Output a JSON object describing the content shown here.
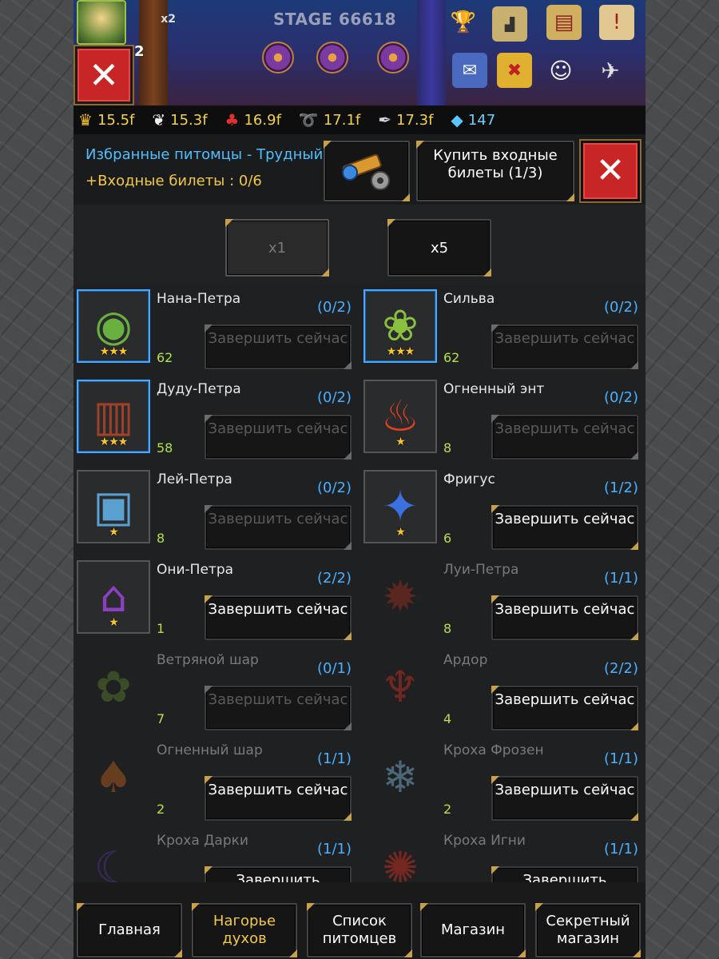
{
  "game": {
    "stage": "STAGE 66618",
    "speed": "x2",
    "hero_level": "2"
  },
  "currencies": [
    {
      "icon": "crown-icon",
      "value": "15.5f"
    },
    {
      "icon": "feather-icon",
      "value": "15.3f"
    },
    {
      "icon": "berry-icon",
      "value": "16.9f"
    },
    {
      "icon": "vine-icon",
      "value": "17.1f"
    },
    {
      "icon": "quill-icon",
      "value": "17.3f"
    },
    {
      "icon": "diamond-icon",
      "value": "147"
    }
  ],
  "header": {
    "title": "Избранные питомцы - Трудный",
    "tickets": "+Входные билеты : 0/6",
    "buy_button": "Купить входные билеты (1/3)"
  },
  "multipliers": {
    "x1": "x1",
    "x5": "x5"
  },
  "pets": [
    {
      "name": "Нана-Петра",
      "count": "(0/2)",
      "level": "62",
      "stars": "★★★",
      "button": "Завершить сейчас"
    },
    {
      "name": "Сильва",
      "count": "(0/2)",
      "level": "62",
      "stars": "★★★",
      "button": "Завершить сейчас"
    },
    {
      "name": "Дуду-Петра",
      "count": "(0/2)",
      "level": "58",
      "stars": "★★★",
      "button": "Завершить сейчас"
    },
    {
      "name": "Огненный энт",
      "count": "(0/2)",
      "level": "8",
      "stars": "★",
      "button": "Завершить сейчас"
    },
    {
      "name": "Лей-Петра",
      "count": "(0/2)",
      "level": "8",
      "stars": "★",
      "button": "Завершить сейчас"
    },
    {
      "name": "Фригус",
      "count": "(1/2)",
      "level": "6",
      "stars": "★",
      "button": "Завершить сейчас"
    },
    {
      "name": "Они-Петра",
      "count": "(2/2)",
      "level": "1",
      "stars": "★",
      "button": "Завершить сейчас"
    },
    {
      "name": "Луи-Петра",
      "count": "(1/1)",
      "level": "8",
      "stars": "",
      "button": "Завершить сейчас"
    },
    {
      "name": "Ветряной шар",
      "count": "(0/1)",
      "level": "7",
      "stars": "",
      "button": "Завершить сейчас"
    },
    {
      "name": "Ардор",
      "count": "(2/2)",
      "level": "4",
      "stars": "",
      "button": "Завершить сейчас"
    },
    {
      "name": "Огненный шар",
      "count": "(1/1)",
      "level": "2",
      "stars": "",
      "button": "Завершить сейчас"
    },
    {
      "name": "Кроха Фрозен",
      "count": "(1/1)",
      "level": "2",
      "stars": "",
      "button": "Завершить сейчас"
    },
    {
      "name": "Кроха Дарки",
      "count": "(1/1)",
      "level": "",
      "stars": "",
      "button": "Завершить"
    },
    {
      "name": "Кроха Игни",
      "count": "(1/1)",
      "level": "",
      "stars": "",
      "button": "Завершить"
    }
  ],
  "nav": {
    "home": "Главная",
    "spirit_hill": "Нагорье духов",
    "pet_list": "Список питомцев",
    "shop": "Магазин",
    "secret_shop": "Секретный магазин"
  }
}
